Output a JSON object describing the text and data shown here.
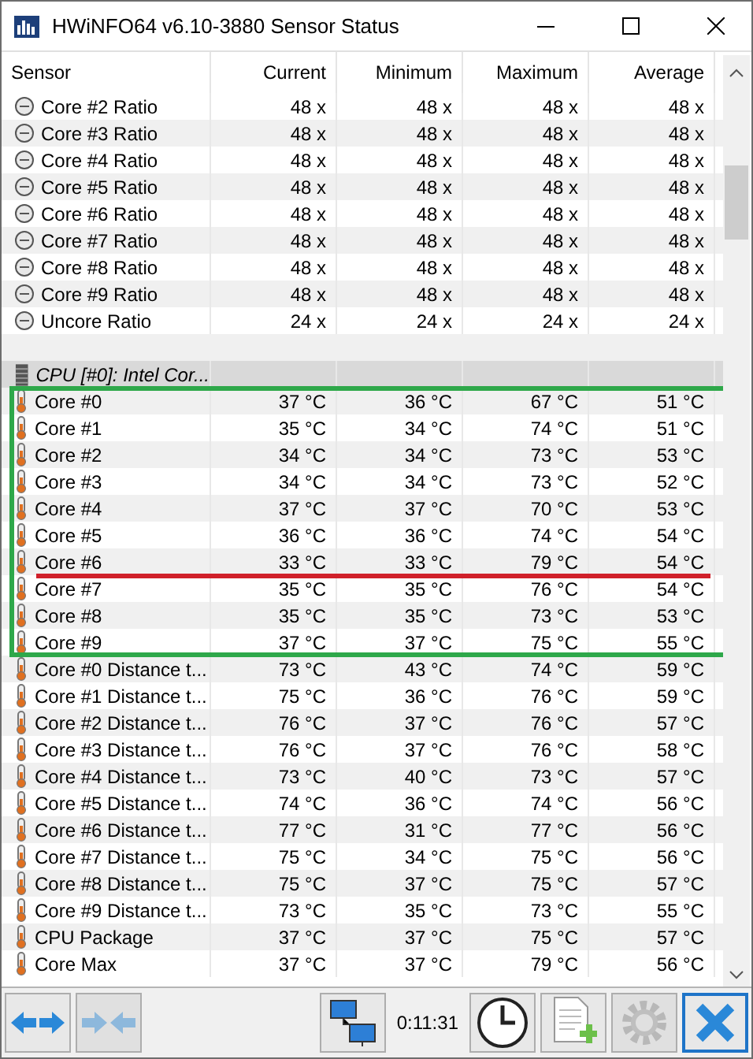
{
  "window": {
    "title": "HWiNFO64 v6.10-3880 Sensor Status"
  },
  "table": {
    "columns": [
      "Sensor",
      "Current",
      "Minimum",
      "Maximum",
      "Average"
    ],
    "blocks": [
      {
        "rows": [
          {
            "kind": "clock",
            "label": "Core #2 Ratio",
            "values": [
              "48 x",
              "48 x",
              "48 x",
              "48 x"
            ]
          },
          {
            "kind": "clock",
            "label": "Core #3 Ratio",
            "values": [
              "48 x",
              "48 x",
              "48 x",
              "48 x"
            ]
          },
          {
            "kind": "clock",
            "label": "Core #4 Ratio",
            "values": [
              "48 x",
              "48 x",
              "48 x",
              "48 x"
            ]
          },
          {
            "kind": "clock",
            "label": "Core #5 Ratio",
            "values": [
              "48 x",
              "48 x",
              "48 x",
              "48 x"
            ]
          },
          {
            "kind": "clock",
            "label": "Core #6 Ratio",
            "values": [
              "48 x",
              "48 x",
              "48 x",
              "48 x"
            ]
          },
          {
            "kind": "clock",
            "label": "Core #7 Ratio",
            "values": [
              "48 x",
              "48 x",
              "48 x",
              "48 x"
            ]
          },
          {
            "kind": "clock",
            "label": "Core #8 Ratio",
            "values": [
              "48 x",
              "48 x",
              "48 x",
              "48 x"
            ]
          },
          {
            "kind": "clock",
            "label": "Core #9 Ratio",
            "values": [
              "48 x",
              "48 x",
              "48 x",
              "48 x"
            ]
          },
          {
            "kind": "clock",
            "label": "Uncore Ratio",
            "values": [
              "24 x",
              "24 x",
              "24 x",
              "24 x"
            ]
          },
          {
            "kind": "spacer"
          },
          {
            "kind": "group",
            "label": "CPU [#0]: Intel Cor..."
          }
        ]
      },
      {
        "boxed": true,
        "rows": [
          {
            "kind": "thermo",
            "label": "Core #0",
            "values": [
              "37 °C",
              "36 °C",
              "67 °C",
              "51 °C"
            ]
          },
          {
            "kind": "thermo",
            "label": "Core #1",
            "values": [
              "35 °C",
              "34 °C",
              "74 °C",
              "51 °C"
            ]
          },
          {
            "kind": "thermo",
            "label": "Core #2",
            "values": [
              "34 °C",
              "34 °C",
              "73 °C",
              "53 °C"
            ]
          },
          {
            "kind": "thermo",
            "label": "Core #3",
            "values": [
              "34 °C",
              "34 °C",
              "73 °C",
              "52 °C"
            ]
          },
          {
            "kind": "thermo",
            "label": "Core #4",
            "values": [
              "37 °C",
              "37 °C",
              "70 °C",
              "53 °C"
            ]
          },
          {
            "kind": "thermo",
            "label": "Core #5",
            "values": [
              "36 °C",
              "36 °C",
              "74 °C",
              "54 °C"
            ]
          },
          {
            "kind": "thermo",
            "label": "Core #6",
            "underlined": true,
            "values": [
              "33 °C",
              "33 °C",
              "79 °C",
              "54 °C"
            ]
          },
          {
            "kind": "thermo",
            "label": "Core #7",
            "values": [
              "35 °C",
              "35 °C",
              "76 °C",
              "54 °C"
            ]
          },
          {
            "kind": "thermo",
            "label": "Core #8",
            "values": [
              "35 °C",
              "35 °C",
              "73 °C",
              "53 °C"
            ]
          },
          {
            "kind": "thermo",
            "label": "Core #9",
            "values": [
              "37 °C",
              "37 °C",
              "75 °C",
              "55 °C"
            ]
          }
        ]
      },
      {
        "rows": [
          {
            "kind": "thermo",
            "label": "Core #0 Distance t...",
            "values": [
              "73 °C",
              "43 °C",
              "74 °C",
              "59 °C"
            ]
          },
          {
            "kind": "thermo",
            "label": "Core #1 Distance t...",
            "values": [
              "75 °C",
              "36 °C",
              "76 °C",
              "59 °C"
            ]
          },
          {
            "kind": "thermo",
            "label": "Core #2 Distance t...",
            "values": [
              "76 °C",
              "37 °C",
              "76 °C",
              "57 °C"
            ]
          },
          {
            "kind": "thermo",
            "label": "Core #3 Distance t...",
            "values": [
              "76 °C",
              "37 °C",
              "76 °C",
              "58 °C"
            ]
          },
          {
            "kind": "thermo",
            "label": "Core #4 Distance t...",
            "values": [
              "73 °C",
              "40 °C",
              "73 °C",
              "57 °C"
            ]
          },
          {
            "kind": "thermo",
            "label": "Core #5 Distance t...",
            "values": [
              "74 °C",
              "36 °C",
              "74 °C",
              "56 °C"
            ]
          },
          {
            "kind": "thermo",
            "label": "Core #6 Distance t...",
            "values": [
              "77 °C",
              "31 °C",
              "77 °C",
              "56 °C"
            ]
          },
          {
            "kind": "thermo",
            "label": "Core #7 Distance t...",
            "values": [
              "75 °C",
              "34 °C",
              "75 °C",
              "56 °C"
            ]
          },
          {
            "kind": "thermo",
            "label": "Core #8 Distance t...",
            "values": [
              "75 °C",
              "37 °C",
              "75 °C",
              "57 °C"
            ]
          },
          {
            "kind": "thermo",
            "label": "Core #9 Distance t...",
            "values": [
              "73 °C",
              "35 °C",
              "73 °C",
              "55 °C"
            ]
          },
          {
            "kind": "thermo",
            "label": "CPU Package",
            "values": [
              "37 °C",
              "37 °C",
              "75 °C",
              "57 °C"
            ]
          },
          {
            "kind": "thermo",
            "label": "Core Max",
            "values": [
              "37 °C",
              "37 °C",
              "79 °C",
              "56 °C"
            ]
          }
        ]
      }
    ]
  },
  "toolbar": {
    "items": [
      {
        "kind": "expand",
        "disabled": false
      },
      {
        "kind": "collapse",
        "disabled": true
      },
      {
        "kind": "network",
        "disabled": false
      },
      {
        "kind": "timer",
        "text": "0:11:31"
      },
      {
        "kind": "clock",
        "disabled": false
      },
      {
        "kind": "report",
        "disabled": false
      },
      {
        "kind": "settings",
        "disabled": true
      },
      {
        "kind": "close",
        "disabled": false
      }
    ]
  }
}
